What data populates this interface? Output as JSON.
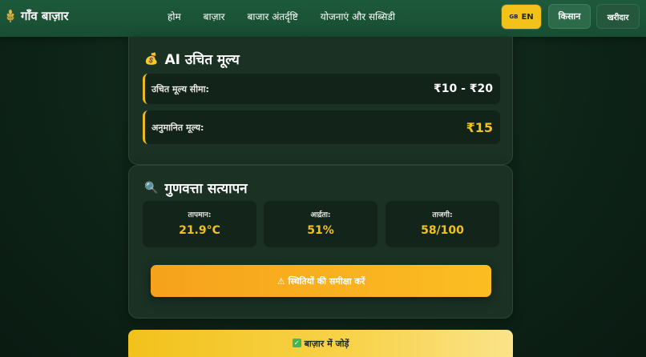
{
  "header": {
    "brand": "गाँव बाज़ार",
    "nav": [
      "होम",
      "बाज़ार",
      "बाजार अंतर्दृष्टि",
      "योजनाएं और सब्सिडी"
    ],
    "lang_flag": "GB",
    "lang_label": "EN",
    "farmer_label": "किसान",
    "buyer_label": "खरीदार"
  },
  "fair_price": {
    "icon": "💰",
    "title": "AI उचित मूल्य",
    "range_label": "उचित मूल्य सीमा:",
    "range_value": "₹10 - ₹20",
    "estimate_label": "अनुमानित मूल्य:",
    "estimate_value": "₹15"
  },
  "quality": {
    "icon": "🔍",
    "title": "गुणवत्ता सत्यापन",
    "metrics": [
      {
        "label": "तापमान:",
        "value": "21.9°C"
      },
      {
        "label": "आर्द्रता:",
        "value": "51%"
      },
      {
        "label": "ताजगी:",
        "value": "58/100"
      }
    ],
    "review_icon": "⚠",
    "review_label": "स्थितियों की समीक्षा करें"
  },
  "add_to_market": {
    "icon": "✓",
    "label": "बाज़ार में जोड़ें"
  },
  "colors": {
    "accent": "#f2c21b",
    "header_bg": "#1d5a3b",
    "card_bg": "#1a3124",
    "warning": "#f6a21c"
  }
}
